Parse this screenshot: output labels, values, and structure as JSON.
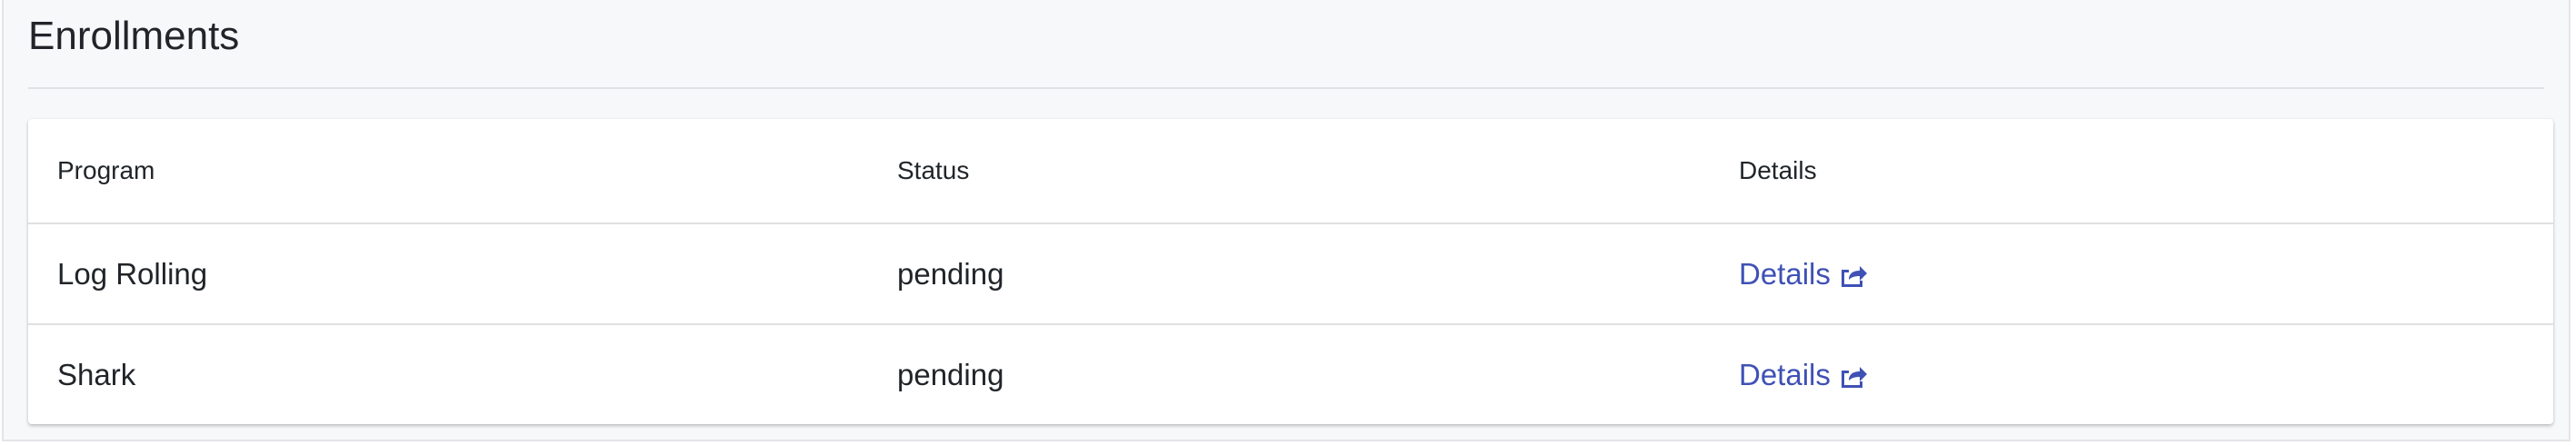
{
  "page": {
    "title": "Enrollments"
  },
  "table": {
    "headers": [
      "Program",
      "Status",
      "Details"
    ],
    "rows": [
      {
        "program": "Log Rolling",
        "status": "pending",
        "details_label": "Details",
        "details_icon": "external-link-icon"
      },
      {
        "program": "Shark",
        "status": "pending",
        "details_label": "Details",
        "details_icon": "external-link-icon"
      }
    ]
  },
  "colors": {
    "link": "#3f51b5",
    "panel_background": "#f7f8fa",
    "text": "#212529"
  }
}
